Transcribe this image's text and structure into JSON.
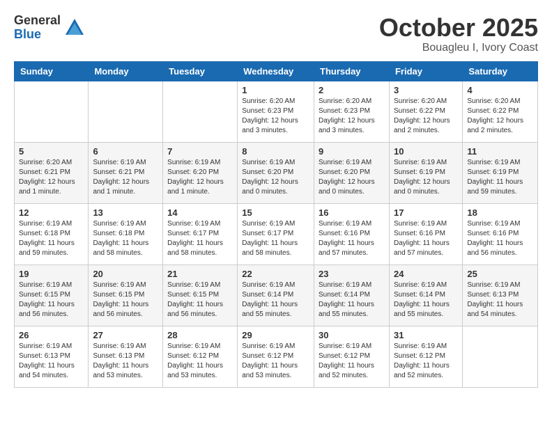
{
  "logo": {
    "general": "General",
    "blue": "Blue"
  },
  "title": "October 2025",
  "location": "Bouagleu I, Ivory Coast",
  "days_header": [
    "Sunday",
    "Monday",
    "Tuesday",
    "Wednesday",
    "Thursday",
    "Friday",
    "Saturday"
  ],
  "weeks": [
    [
      {
        "day": "",
        "info": ""
      },
      {
        "day": "",
        "info": ""
      },
      {
        "day": "",
        "info": ""
      },
      {
        "day": "1",
        "info": "Sunrise: 6:20 AM\nSunset: 6:23 PM\nDaylight: 12 hours\nand 3 minutes."
      },
      {
        "day": "2",
        "info": "Sunrise: 6:20 AM\nSunset: 6:23 PM\nDaylight: 12 hours\nand 3 minutes."
      },
      {
        "day": "3",
        "info": "Sunrise: 6:20 AM\nSunset: 6:22 PM\nDaylight: 12 hours\nand 2 minutes."
      },
      {
        "day": "4",
        "info": "Sunrise: 6:20 AM\nSunset: 6:22 PM\nDaylight: 12 hours\nand 2 minutes."
      }
    ],
    [
      {
        "day": "5",
        "info": "Sunrise: 6:20 AM\nSunset: 6:21 PM\nDaylight: 12 hours\nand 1 minute."
      },
      {
        "day": "6",
        "info": "Sunrise: 6:19 AM\nSunset: 6:21 PM\nDaylight: 12 hours\nand 1 minute."
      },
      {
        "day": "7",
        "info": "Sunrise: 6:19 AM\nSunset: 6:20 PM\nDaylight: 12 hours\nand 1 minute."
      },
      {
        "day": "8",
        "info": "Sunrise: 6:19 AM\nSunset: 6:20 PM\nDaylight: 12 hours\nand 0 minutes."
      },
      {
        "day": "9",
        "info": "Sunrise: 6:19 AM\nSunset: 6:20 PM\nDaylight: 12 hours\nand 0 minutes."
      },
      {
        "day": "10",
        "info": "Sunrise: 6:19 AM\nSunset: 6:19 PM\nDaylight: 12 hours\nand 0 minutes."
      },
      {
        "day": "11",
        "info": "Sunrise: 6:19 AM\nSunset: 6:19 PM\nDaylight: 11 hours\nand 59 minutes."
      }
    ],
    [
      {
        "day": "12",
        "info": "Sunrise: 6:19 AM\nSunset: 6:18 PM\nDaylight: 11 hours\nand 59 minutes."
      },
      {
        "day": "13",
        "info": "Sunrise: 6:19 AM\nSunset: 6:18 PM\nDaylight: 11 hours\nand 58 minutes."
      },
      {
        "day": "14",
        "info": "Sunrise: 6:19 AM\nSunset: 6:17 PM\nDaylight: 11 hours\nand 58 minutes."
      },
      {
        "day": "15",
        "info": "Sunrise: 6:19 AM\nSunset: 6:17 PM\nDaylight: 11 hours\nand 58 minutes."
      },
      {
        "day": "16",
        "info": "Sunrise: 6:19 AM\nSunset: 6:16 PM\nDaylight: 11 hours\nand 57 minutes."
      },
      {
        "day": "17",
        "info": "Sunrise: 6:19 AM\nSunset: 6:16 PM\nDaylight: 11 hours\nand 57 minutes."
      },
      {
        "day": "18",
        "info": "Sunrise: 6:19 AM\nSunset: 6:16 PM\nDaylight: 11 hours\nand 56 minutes."
      }
    ],
    [
      {
        "day": "19",
        "info": "Sunrise: 6:19 AM\nSunset: 6:15 PM\nDaylight: 11 hours\nand 56 minutes."
      },
      {
        "day": "20",
        "info": "Sunrise: 6:19 AM\nSunset: 6:15 PM\nDaylight: 11 hours\nand 56 minutes."
      },
      {
        "day": "21",
        "info": "Sunrise: 6:19 AM\nSunset: 6:15 PM\nDaylight: 11 hours\nand 56 minutes."
      },
      {
        "day": "22",
        "info": "Sunrise: 6:19 AM\nSunset: 6:14 PM\nDaylight: 11 hours\nand 55 minutes."
      },
      {
        "day": "23",
        "info": "Sunrise: 6:19 AM\nSunset: 6:14 PM\nDaylight: 11 hours\nand 55 minutes."
      },
      {
        "day": "24",
        "info": "Sunrise: 6:19 AM\nSunset: 6:14 PM\nDaylight: 11 hours\nand 55 minutes."
      },
      {
        "day": "25",
        "info": "Sunrise: 6:19 AM\nSunset: 6:13 PM\nDaylight: 11 hours\nand 54 minutes."
      }
    ],
    [
      {
        "day": "26",
        "info": "Sunrise: 6:19 AM\nSunset: 6:13 PM\nDaylight: 11 hours\nand 54 minutes."
      },
      {
        "day": "27",
        "info": "Sunrise: 6:19 AM\nSunset: 6:13 PM\nDaylight: 11 hours\nand 53 minutes."
      },
      {
        "day": "28",
        "info": "Sunrise: 6:19 AM\nSunset: 6:12 PM\nDaylight: 11 hours\nand 53 minutes."
      },
      {
        "day": "29",
        "info": "Sunrise: 6:19 AM\nSunset: 6:12 PM\nDaylight: 11 hours\nand 53 minutes."
      },
      {
        "day": "30",
        "info": "Sunrise: 6:19 AM\nSunset: 6:12 PM\nDaylight: 11 hours\nand 52 minutes."
      },
      {
        "day": "31",
        "info": "Sunrise: 6:19 AM\nSunset: 6:12 PM\nDaylight: 11 hours\nand 52 minutes."
      },
      {
        "day": "",
        "info": ""
      }
    ]
  ]
}
